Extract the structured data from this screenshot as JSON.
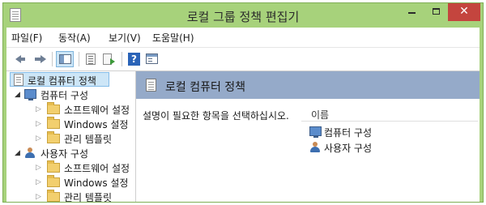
{
  "window": {
    "title": "로컬 그룹 정책 편집기",
    "controls": {
      "minimize": "minimize",
      "maximize": "maximize",
      "close": "✕"
    },
    "accent_color": "#a7d27b",
    "close_color": "#c4453e"
  },
  "menu": [
    "파일(F)",
    "동작(A)",
    "보기(V)",
    "도움말(H)"
  ],
  "toolbar": {
    "buttons": [
      "back-icon",
      "forward-icon",
      "show-hide-tree-icon",
      "list-view-icon",
      "export-list-icon",
      "help-icon",
      "properties-icon"
    ],
    "help_glyph": "?"
  },
  "tree": {
    "root": "로컬 컴퓨터 정책",
    "computer": "컴퓨터 구성",
    "user": "사용자 구성",
    "children": [
      "소프트웨어 설정",
      "Windows 설정",
      "관리 템플릿"
    ],
    "expanded_glyph": "◢",
    "collapsed_glyph": "▷"
  },
  "content": {
    "header_title": "로컬 컴퓨터 정책",
    "header_color": "#95aac9",
    "description": "설명이 필요한 항목을 선택하십시오.",
    "list": {
      "column": "이름",
      "items": [
        "컴퓨터 구성",
        "사용자 구성"
      ]
    }
  }
}
